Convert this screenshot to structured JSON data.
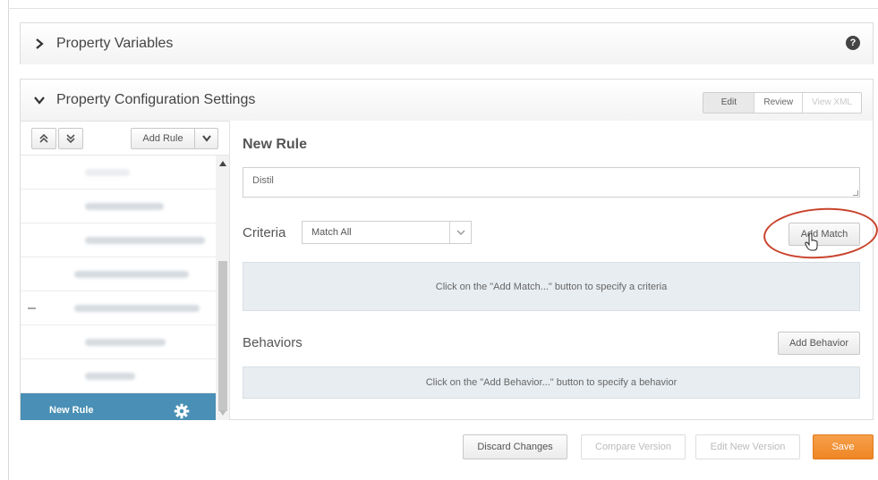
{
  "property_variables": {
    "title": "Property Variables",
    "help_icon": "help-icon"
  },
  "config": {
    "title": "Property Configuration Settings",
    "modes": [
      "Edit",
      "Review",
      "View XML"
    ]
  },
  "tree": {
    "toolbar": {
      "add_rule_label": "Add Rule"
    },
    "selected_item": {
      "label": "New Rule"
    },
    "colors": {
      "selected_bg": "#4a8fb5"
    }
  },
  "rule": {
    "heading": "New Rule",
    "name_value": "Distil",
    "criteria": {
      "label": "Criteria",
      "select_value": "Match All",
      "add_match_label": "Add Match",
      "empty_message": "Click on the \"Add Match...\" button to specify a criteria"
    },
    "behaviors": {
      "label": "Behaviors",
      "add_behavior_label": "Add Behavior",
      "empty_message": "Click on the \"Add Behavior...\" button to specify a behavior"
    }
  },
  "footer": {
    "discard": "Discard Changes",
    "compare": "Compare Version",
    "edit_new": "Edit New Version",
    "save": "Save"
  },
  "colors": {
    "save": "#ee8624",
    "annotation": "#c8432c"
  }
}
